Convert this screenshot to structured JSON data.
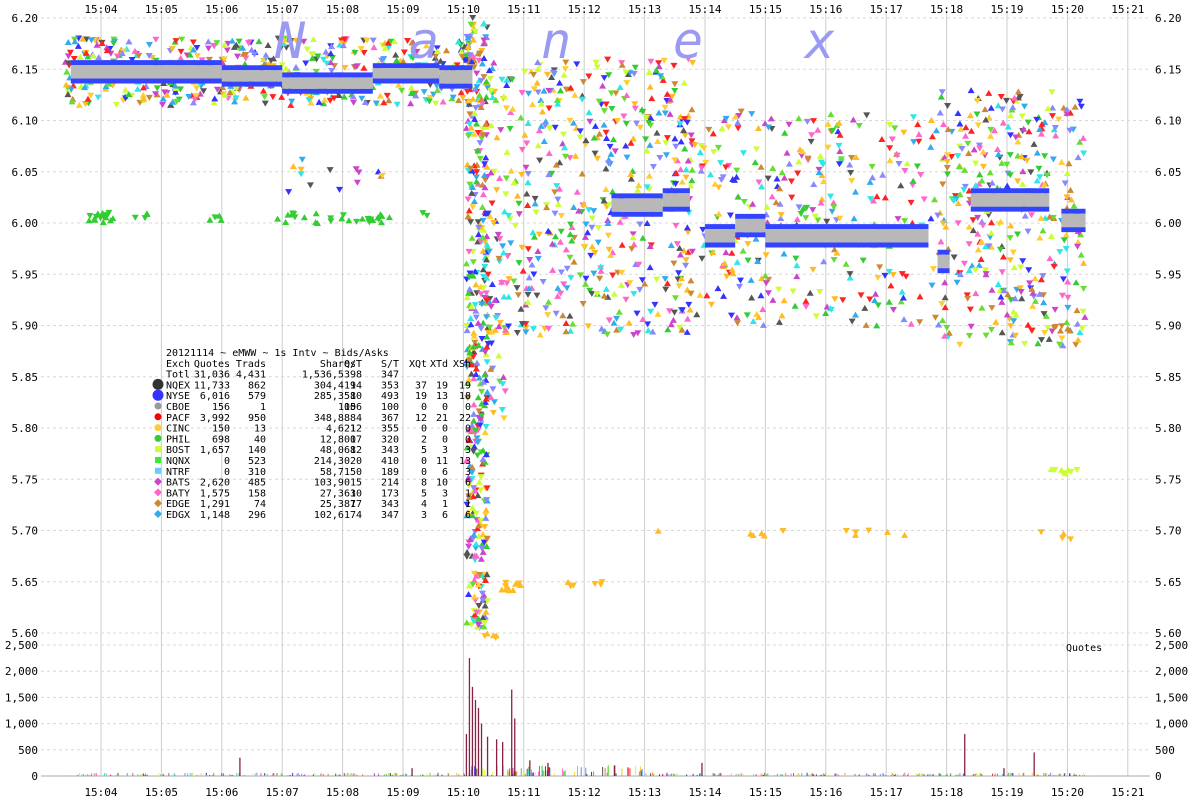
{
  "chart_data": {
    "type": "scatter",
    "watermark": [
      "N",
      "a",
      "n",
      "e",
      "x"
    ],
    "x_ticks": [
      "15:04",
      "15:05",
      "15:06",
      "15:07",
      "15:08",
      "15:09",
      "15:10",
      "15:11",
      "15:12",
      "15:13",
      "15:14",
      "15:15",
      "15:16",
      "15:17",
      "15:18",
      "15:19",
      "15:20",
      "15:21"
    ],
    "price_axis": {
      "ylim": [
        5.6,
        6.2
      ],
      "ticks": [
        "5.60",
        "5.65",
        "5.70",
        "5.75",
        "5.80",
        "5.85",
        "5.90",
        "5.95",
        "6.00",
        "6.05",
        "6.10",
        "6.15",
        "6.20"
      ]
    },
    "volume_axis": {
      "label": "Quotes",
      "ylim": [
        0,
        2500
      ],
      "ticks": [
        "0",
        "500",
        "1,000",
        "1,500",
        "2,000",
        "2,500"
      ]
    },
    "grid": true,
    "legend_title": "20121114 ~ eMWW ~ 1s Intv ~ Bids/Asks",
    "legend_columns": [
      "Exch",
      "Quotes",
      "Trads",
      "Shares",
      "Q/T",
      "S/T",
      "XQt",
      "XTd",
      "XSh"
    ],
    "legend_rows": [
      {
        "exch": "Totl",
        "quotes": "31,036",
        "trads": "4,431",
        "shares": "1,536,539",
        "qt": "8",
        "st": "347",
        "xqt": "",
        "xtd": "",
        "xsh": "",
        "color": "",
        "marker": "none"
      },
      {
        "exch": "NQEX",
        "quotes": "11,733",
        "trads": "862",
        "shares": "304,419",
        "qt": "14",
        "st": "353",
        "xqt": "37",
        "xtd": "19",
        "xsh": "19",
        "color": "#333333",
        "marker": "octagon"
      },
      {
        "exch": "NYSE",
        "quotes": "6,016",
        "trads": "579",
        "shares": "285,358",
        "qt": "10",
        "st": "493",
        "xqt": "19",
        "xtd": "13",
        "xsh": "18",
        "color": "#3333ff",
        "marker": "octagon"
      },
      {
        "exch": "CBOE",
        "quotes": "156",
        "trads": "1",
        "shares": "100",
        "qt": "156",
        "st": "100",
        "xqt": "0",
        "xtd": "0",
        "xsh": "0",
        "color": "#999999",
        "marker": "circle"
      },
      {
        "exch": "PACF",
        "quotes": "3,992",
        "trads": "950",
        "shares": "348,888",
        "qt": "4",
        "st": "367",
        "xqt": "12",
        "xtd": "21",
        "xsh": "22",
        "color": "#ff0000",
        "marker": "circle"
      },
      {
        "exch": "CINC",
        "quotes": "150",
        "trads": "13",
        "shares": "4,621",
        "qt": "12",
        "st": "355",
        "xqt": "0",
        "xtd": "0",
        "xsh": "0",
        "color": "#ffcc33",
        "marker": "circle"
      },
      {
        "exch": "PHIL",
        "quotes": "698",
        "trads": "40",
        "shares": "12,800",
        "qt": "17",
        "st": "320",
        "xqt": "2",
        "xtd": "0",
        "xsh": "0",
        "color": "#33cc33",
        "marker": "circle"
      },
      {
        "exch": "BOST",
        "quotes": "1,657",
        "trads": "140",
        "shares": "48,068",
        "qt": "12",
        "st": "343",
        "xqt": "5",
        "xtd": "3",
        "xsh": "3",
        "color": "#ccff33",
        "marker": "square"
      },
      {
        "exch": "NQNX",
        "quotes": "0",
        "trads": "523",
        "shares": "214,302",
        "qt": "0",
        "st": "410",
        "xqt": "0",
        "xtd": "11",
        "xsh": "13",
        "color": "#33ee33",
        "marker": "square"
      },
      {
        "exch": "NTRF",
        "quotes": "0",
        "trads": "310",
        "shares": "58,715",
        "qt": "0",
        "st": "189",
        "xqt": "0",
        "xtd": "6",
        "xsh": "3",
        "color": "#66ccff",
        "marker": "square"
      },
      {
        "exch": "BATS",
        "quotes": "2,620",
        "trads": "485",
        "shares": "103,901",
        "qt": "5",
        "st": "214",
        "xqt": "8",
        "xtd": "10",
        "xsh": "6",
        "color": "#cc44cc",
        "marker": "diamond"
      },
      {
        "exch": "BATY",
        "quotes": "1,575",
        "trads": "158",
        "shares": "27,363",
        "qt": "10",
        "st": "173",
        "xqt": "5",
        "xtd": "3",
        "xsh": "1",
        "color": "#ff66cc",
        "marker": "diamond"
      },
      {
        "exch": "EDGE",
        "quotes": "1,291",
        "trads": "74",
        "shares": "25,387",
        "qt": "17",
        "st": "343",
        "xqt": "4",
        "xtd": "1",
        "xsh": "1",
        "color": "#cc8833",
        "marker": "diamond"
      },
      {
        "exch": "EDGX",
        "quotes": "1,148",
        "trads": "296",
        "shares": "102,617",
        "qt": "4",
        "st": "347",
        "xqt": "3",
        "xtd": "6",
        "xsh": "6",
        "color": "#33aaee",
        "marker": "diamond"
      }
    ],
    "nbbo_segments": [
      {
        "t0": -0.5,
        "t1": 2.0,
        "bid": 6.14,
        "ask": 6.155
      },
      {
        "t0": 2.0,
        "t1": 3.0,
        "bid": 6.137,
        "ask": 6.15
      },
      {
        "t0": 3.0,
        "t1": 4.5,
        "bid": 6.13,
        "ask": 6.143
      },
      {
        "t0": 4.5,
        "t1": 5.6,
        "bid": 6.14,
        "ask": 6.152
      },
      {
        "t0": 5.6,
        "t1": 6.15,
        "bid": 6.135,
        "ask": 6.15
      },
      {
        "t0": 8.45,
        "t1": 9.3,
        "bid": 6.01,
        "ask": 6.025
      },
      {
        "t0": 9.3,
        "t1": 9.75,
        "bid": 6.015,
        "ask": 6.03
      },
      {
        "t0": 10.0,
        "t1": 10.5,
        "bid": 5.98,
        "ask": 5.995
      },
      {
        "t0": 10.5,
        "t1": 11.0,
        "bid": 5.99,
        "ask": 6.005
      },
      {
        "t0": 11.0,
        "t1": 13.7,
        "bid": 5.98,
        "ask": 5.995
      },
      {
        "t0": 13.85,
        "t1": 14.05,
        "bid": 5.955,
        "ask": 5.97
      },
      {
        "t0": 14.4,
        "t1": 15.7,
        "bid": 6.015,
        "ask": 6.03
      },
      {
        "t0": 15.9,
        "t1": 16.3,
        "bid": 5.995,
        "ask": 6.01
      }
    ],
    "scatter_clusters": [
      {
        "t0": -0.6,
        "t1": 6.1,
        "ymin": 6.115,
        "ymax": 6.18,
        "count": 520
      },
      {
        "t0": -0.2,
        "t1": 0.2,
        "ymin": 6.0,
        "ymax": 6.01,
        "count": 18,
        "color": "#33cc33"
      },
      {
        "t0": 0.5,
        "t1": 0.8,
        "ymin": 6.0,
        "ymax": 6.01,
        "count": 4,
        "color": "#33cc33"
      },
      {
        "t0": 1.8,
        "t1": 2.1,
        "ymin": 6.0,
        "ymax": 6.01,
        "count": 4,
        "color": "#33cc33"
      },
      {
        "t0": 2.9,
        "t1": 4.8,
        "ymin": 6.0,
        "ymax": 6.01,
        "count": 30,
        "color": "#33cc33"
      },
      {
        "t0": 5.3,
        "t1": 5.4,
        "ymin": 6.0,
        "ymax": 6.01,
        "count": 2,
        "color": "#33cc33"
      },
      {
        "t0": 2.9,
        "t1": 4.8,
        "ymin": 6.03,
        "ymax": 6.07,
        "count": 14
      },
      {
        "t0": 6.05,
        "t1": 6.4,
        "ymin": 5.6,
        "ymax": 6.2,
        "count": 380
      },
      {
        "t0": 6.3,
        "t1": 9.8,
        "ymin": 5.89,
        "ymax": 6.16,
        "count": 520
      },
      {
        "t0": 9.5,
        "t1": 13.9,
        "ymin": 5.9,
        "ymax": 6.11,
        "count": 360
      },
      {
        "t0": 13.9,
        "t1": 16.3,
        "ymin": 5.88,
        "ymax": 6.13,
        "count": 360
      },
      {
        "t0": 6.35,
        "t1": 6.7,
        "ymin": 5.8,
        "ymax": 5.98,
        "count": 40
      },
      {
        "t0": 6.55,
        "t1": 7.0,
        "ymin": 5.64,
        "ymax": 5.65,
        "count": 10,
        "color": "#ffbb22"
      },
      {
        "t0": 7.7,
        "t1": 8.3,
        "ymin": 5.645,
        "ymax": 5.65,
        "count": 6,
        "color": "#ffbb22"
      },
      {
        "t0": 8.7,
        "t1": 13.9,
        "ymin": 5.695,
        "ymax": 5.7,
        "count": 12,
        "color": "#ffbb22"
      },
      {
        "t0": 15.5,
        "t1": 16.1,
        "ymin": 5.69,
        "ymax": 5.7,
        "count": 4,
        "color": "#ffbb22"
      },
      {
        "t0": 15.7,
        "t1": 16.2,
        "ymin": 5.755,
        "ymax": 5.76,
        "count": 8,
        "color": "#ccff33"
      },
      {
        "t0": 15.75,
        "t1": 16.2,
        "ymin": 5.895,
        "ymax": 5.9,
        "count": 6,
        "color": "#cc8833"
      },
      {
        "t0": 6.35,
        "t1": 6.55,
        "ymin": 5.595,
        "ymax": 5.6,
        "count": 5,
        "color": "#ffbb22"
      }
    ],
    "volume_spikes": [
      {
        "t": 6.1,
        "v": 2250
      },
      {
        "t": 6.15,
        "v": 1700
      },
      {
        "t": 6.2,
        "v": 1450
      },
      {
        "t": 6.05,
        "v": 800
      },
      {
        "t": 6.3,
        "v": 1000
      },
      {
        "t": 6.4,
        "v": 750
      },
      {
        "t": 6.55,
        "v": 700
      },
      {
        "t": 6.65,
        "v": 650
      },
      {
        "t": 6.8,
        "v": 1650
      },
      {
        "t": 6.85,
        "v": 1100
      },
      {
        "t": 6.25,
        "v": 1300
      },
      {
        "t": 7.1,
        "v": 300
      },
      {
        "t": 7.4,
        "v": 250
      },
      {
        "t": 8.5,
        "v": 200
      },
      {
        "t": 14.3,
        "v": 800
      },
      {
        "t": 2.3,
        "v": 350
      },
      {
        "t": 5.15,
        "v": 150
      },
      {
        "t": 15.45,
        "v": 450
      },
      {
        "t": 9.95,
        "v": 250
      },
      {
        "t": 14.95,
        "v": 150
      }
    ]
  }
}
